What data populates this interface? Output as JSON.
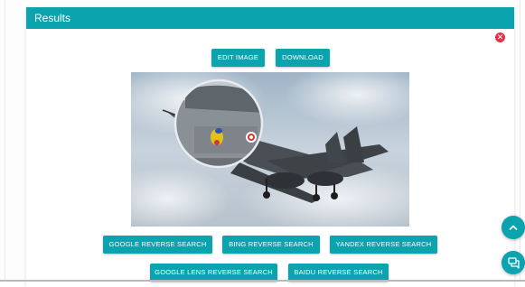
{
  "header": {
    "title": "Results"
  },
  "close_icon": "close-icon",
  "actions": {
    "edit_image": "EDIT IMAGE",
    "download": "DOWNLOAD"
  },
  "image": {
    "icon": "image-preview-icon"
  },
  "search_buttons": {
    "google": "GOOGLE REVERSE SEARCH",
    "bing": "BING REVERSE SEARCH",
    "yandex": "YANDEX REVERSE SEARCH",
    "google_lens": "GOOGLE LENS REVERSE SEARCH",
    "baidu": "BAIDU REVERSE SEARCH"
  },
  "floating": {
    "scroll_top_icon": "chevron-up-icon",
    "chat_icon": "chat-icon"
  },
  "colors": {
    "accent": "#0aa3ae",
    "close": "#e0344b"
  }
}
